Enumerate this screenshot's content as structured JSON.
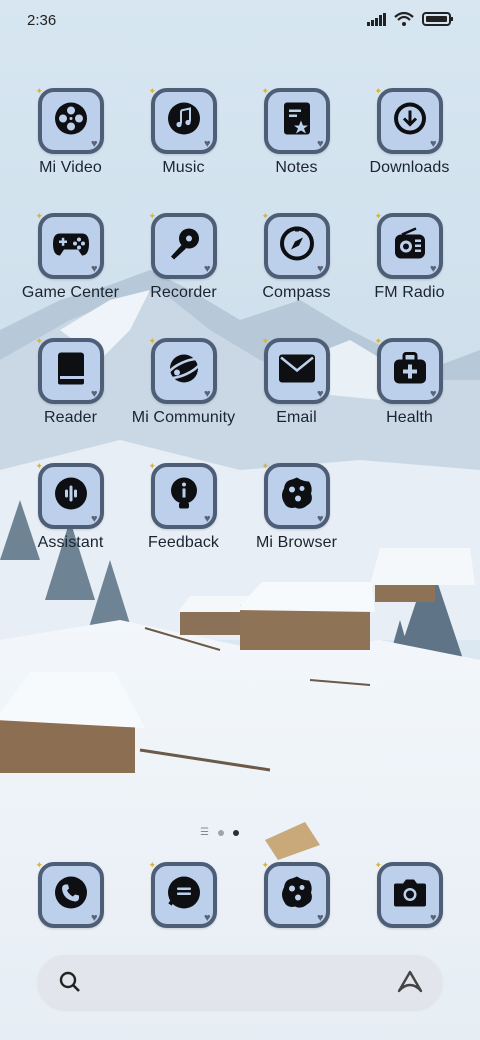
{
  "status_bar": {
    "time": "2:36",
    "icons": [
      "signal-icon",
      "wifi-icon",
      "battery-icon"
    ]
  },
  "apps": [
    {
      "label": "Mi Video",
      "icon": "film-reel-icon"
    },
    {
      "label": "Music",
      "icon": "music-note-icon"
    },
    {
      "label": "Notes",
      "icon": "notes-icon"
    },
    {
      "label": "Downloads",
      "icon": "download-icon"
    },
    {
      "label": "Game Center",
      "icon": "gamepad-icon"
    },
    {
      "label": "Recorder",
      "icon": "microphone-icon"
    },
    {
      "label": "Compass",
      "icon": "compass-icon"
    },
    {
      "label": "FM Radio",
      "icon": "radio-icon"
    },
    {
      "label": "Reader",
      "icon": "book-icon"
    },
    {
      "label": "Mi Community",
      "icon": "planet-icon"
    },
    {
      "label": "Email",
      "icon": "envelope-icon"
    },
    {
      "label": "Health",
      "icon": "first-aid-kit-icon"
    },
    {
      "label": "Assistant",
      "icon": "voice-wave-icon"
    },
    {
      "label": "Feedback",
      "icon": "info-bulb-icon"
    },
    {
      "label": "Mi Browser",
      "icon": "browser-blob-icon"
    }
  ],
  "dock": [
    {
      "icon": "phone-icon"
    },
    {
      "icon": "message-icon"
    },
    {
      "icon": "browser-blob-icon"
    },
    {
      "icon": "camera-icon"
    }
  ],
  "page_indicator": {
    "pages": 2,
    "active": 2
  },
  "search_bar": {
    "icons": [
      "search-icon",
      "assistant-logo-icon"
    ]
  },
  "colors": {
    "icon_bg": "#bcd0ec",
    "icon_border": "#4d5e76",
    "glyph": "#0e0f12",
    "sparkle": "#d9b23a"
  }
}
